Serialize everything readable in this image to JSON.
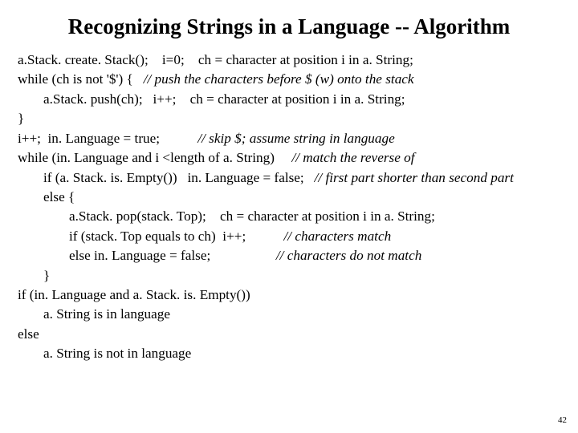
{
  "title": "Recognizing Strings in a Language -- Algorithm",
  "lines": [
    {
      "indent": 0,
      "segs": [
        {
          "t": "a.Stack. create. Stack();    i=0;    ch = character at position i in a. String;"
        }
      ]
    },
    {
      "indent": 0,
      "segs": [
        {
          "t": "while (ch is not '$') {   "
        },
        {
          "t": "// push the characters before $ (w) onto the stack",
          "em": true
        }
      ]
    },
    {
      "indent": 1,
      "segs": [
        {
          "t": "a.Stack. push(ch);   i++;    ch = character at position i in a. String;"
        }
      ]
    },
    {
      "indent": 0,
      "segs": [
        {
          "t": "}"
        }
      ]
    },
    {
      "indent": 0,
      "segs": [
        {
          "t": "i++;  in. Language = true;           "
        },
        {
          "t": "// skip $; assume string in language",
          "em": true
        }
      ]
    },
    {
      "indent": 0,
      "segs": [
        {
          "t": "while (in. Language and i <length of a. String)     "
        },
        {
          "t": "// match the reverse of",
          "em": true
        }
      ]
    },
    {
      "indent": 1,
      "segs": [
        {
          "t": "if (a. Stack. is. Empty())   in. Language = false;   "
        },
        {
          "t": "// first part shorter than second part",
          "em": true
        }
      ]
    },
    {
      "indent": 1,
      "segs": [
        {
          "t": "else {"
        }
      ]
    },
    {
      "indent": 2,
      "segs": [
        {
          "t": "a.Stack. pop(stack. Top);    ch = character at position i in a. String;"
        }
      ]
    },
    {
      "indent": 2,
      "segs": [
        {
          "t": "if (stack. Top equals to ch)  i++;           "
        },
        {
          "t": "// characters match",
          "em": true
        }
      ]
    },
    {
      "indent": 2,
      "segs": [
        {
          "t": "else in. Language = false;                   "
        },
        {
          "t": "// characters do not match",
          "em": true
        }
      ]
    },
    {
      "indent": 1,
      "segs": [
        {
          "t": "}"
        }
      ]
    },
    {
      "indent": 0,
      "segs": [
        {
          "t": "if (in. Language and a. Stack. is. Empty())"
        }
      ]
    },
    {
      "indent": 1,
      "segs": [
        {
          "t": "a. String is in language"
        }
      ]
    },
    {
      "indent": 0,
      "segs": [
        {
          "t": "else"
        }
      ]
    },
    {
      "indent": 1,
      "segs": [
        {
          "t": "a. String is not in language"
        }
      ]
    }
  ],
  "page": "42"
}
